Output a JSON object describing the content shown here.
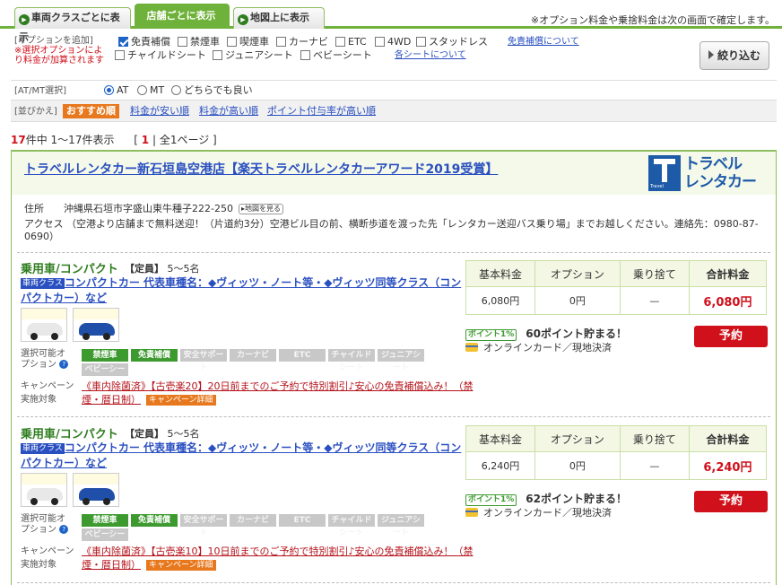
{
  "tabs": [
    {
      "label": "車両クラスごとに表示"
    },
    {
      "label": "店舗ごとに表示"
    },
    {
      "label": "地図上に表示"
    }
  ],
  "top_note": "※オプション料金や乗捨料金は次の画面で確定します。",
  "filter": {
    "options_label": "[オプションを追加]",
    "options_note": "※選択オプションにより料金が加算されます",
    "options": [
      {
        "label": "免責補償",
        "checked": true
      },
      {
        "label": "禁煙車",
        "checked": false
      },
      {
        "label": "喫煙車",
        "checked": false
      },
      {
        "label": "カーナビ",
        "checked": false
      },
      {
        "label": "ETC",
        "checked": false
      },
      {
        "label": "4WD",
        "checked": false
      },
      {
        "label": "スタッドレス",
        "checked": false
      },
      {
        "label": "チャイルドシート",
        "checked": false
      },
      {
        "label": "ジュニアシート",
        "checked": false
      },
      {
        "label": "ベビーシート",
        "checked": false
      }
    ],
    "link_menseki": "免責補償について",
    "link_seats": "各シートについて",
    "narrow_button": "絞り込む",
    "atmt_label": "[AT/MT選択]",
    "atmt": [
      {
        "label": "AT",
        "checked": true
      },
      {
        "label": "MT",
        "checked": false
      },
      {
        "label": "どちらでも良い",
        "checked": false
      }
    ],
    "sort_label": "[並びかえ]",
    "sort_active": "おすすめ順",
    "sort_links": [
      "料金が安い順",
      "料金が高い順",
      "ポイント付与率が高い順"
    ]
  },
  "count": {
    "num": "17",
    "unit": "件中",
    "range": "1〜17件表示",
    "page_open": "[",
    "page_num": "1",
    "page_rest": "| 全1ページ ]"
  },
  "shop": {
    "name": "トラベルレンタカー新石垣島空港店【楽天トラベルレンタカーアワード2019受賞】",
    "logo_line1": "トラベル",
    "logo_line2": "レンタカー",
    "logo_mark_text": "Travel",
    "address_key": "住所",
    "address": "沖縄県石垣市字盛山東牛種子222-250",
    "map_button": "地図を見る",
    "access_key": "アクセス",
    "access": "（空港より店舗まで無料送迎！（片道約3分）空港ビル目の前、横断歩道を渡った先「レンタカー送迎バス乗り場」までお越しください。連絡先：0980-87-0690）"
  },
  "table_headers": {
    "base": "基本料金",
    "option": "オプション",
    "dropoff": "乗り捨て",
    "total": "合計料金"
  },
  "plans": [
    {
      "title": "乗用車/コンパクト",
      "capacity_key": "【定員】",
      "capacity": "5〜5名",
      "class_badge": "車両クラス",
      "class_text": "コンパクトカー 代表車種名：◆ヴィッツ・ノート等・◆ヴィッツ同等クラス（コンパクトカー）など",
      "options_label": "選択可能オプション",
      "chips": [
        {
          "label": "禁煙車",
          "on": true
        },
        {
          "label": "免責補償",
          "on": true
        },
        {
          "label": "安全サポート",
          "on": false
        },
        {
          "label": "カーナビ",
          "on": false
        },
        {
          "label": "ETC",
          "on": false
        },
        {
          "label": "チャイルドシート",
          "on": false
        },
        {
          "label": "ジュニアシート",
          "on": false
        },
        {
          "label": "ベビーシート",
          "on": false
        }
      ],
      "campaign_label": "キャンペーン実施対象",
      "campaign_text": "《車内除菌済》【古壱楽20】20日前までのご予約で特別割引♪安心の免責補償込み！（禁煙・暦日制）",
      "campaign_button": "キャンペーン詳細",
      "base": "6,080円",
      "option": "0円",
      "dropoff": "—",
      "total": "6,080円",
      "point_badge": "ポイント1%",
      "points": "60ポイント貯まる！",
      "payment": "オンラインカード／現地決済",
      "reserve": "予約"
    },
    {
      "title": "乗用車/コンパクト",
      "capacity_key": "【定員】",
      "capacity": "5〜5名",
      "class_badge": "車両クラス",
      "class_text": "コンパクトカー 代表車種名：◆ヴィッツ・ノート等・◆ヴィッツ同等クラス（コンパクトカー）など",
      "options_label": "選択可能オプション",
      "chips": [
        {
          "label": "禁煙車",
          "on": true
        },
        {
          "label": "免責補償",
          "on": true
        },
        {
          "label": "安全サポート",
          "on": false
        },
        {
          "label": "カーナビ",
          "on": false
        },
        {
          "label": "ETC",
          "on": false
        },
        {
          "label": "チャイルドシート",
          "on": false
        },
        {
          "label": "ジュニアシート",
          "on": false
        },
        {
          "label": "ベビーシート",
          "on": false
        }
      ],
      "campaign_label": "キャンペーン実施対象",
      "campaign_text": "《車内除菌済》【古壱楽10】10日前までのご予約で特別割引♪安心の免責補償込み！（禁煙・暦日制）",
      "campaign_button": "キャンペーン詳細",
      "base": "6,240円",
      "option": "0円",
      "dropoff": "—",
      "total": "6,240円",
      "point_badge": "ポイント1%",
      "points": "62ポイント貯まる！",
      "payment": "オンラインカード／現地決済",
      "reserve": "予約"
    }
  ]
}
